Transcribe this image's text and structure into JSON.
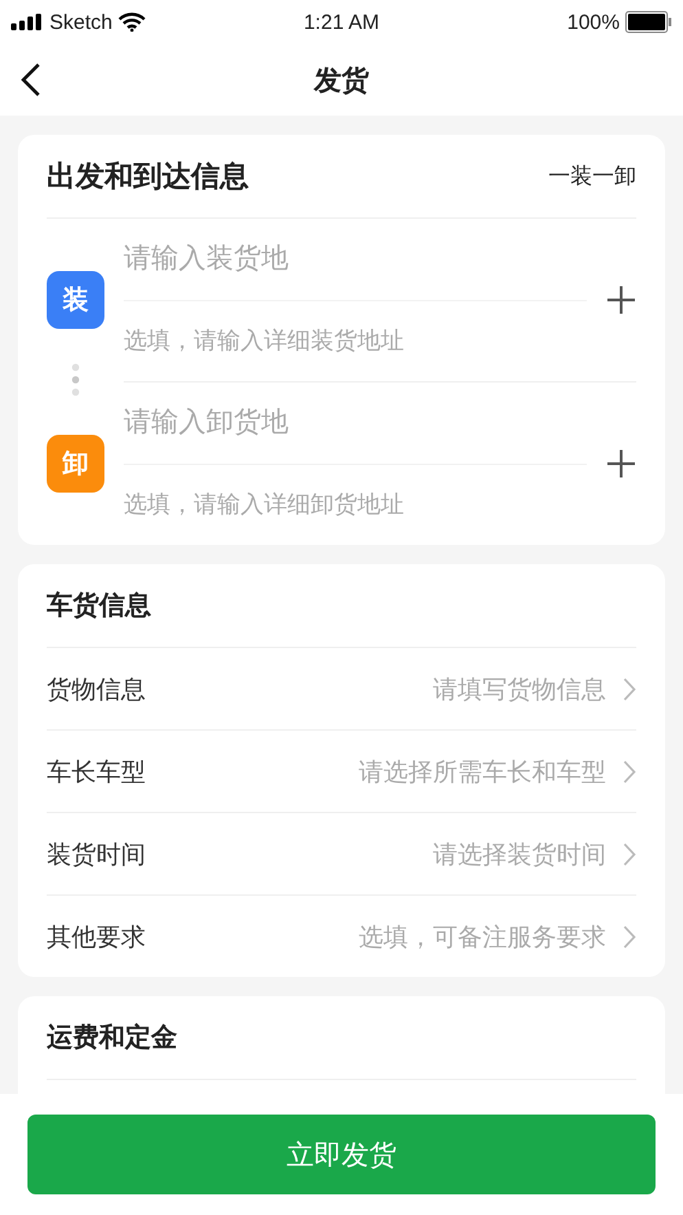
{
  "status_bar": {
    "carrier": "Sketch",
    "time": "1:21 AM",
    "battery": "100%"
  },
  "nav": {
    "title": "发货"
  },
  "route": {
    "title": "出发和到达信息",
    "mode": "一装一卸",
    "stops": [
      {
        "badge": "装",
        "color": "#3a7ff6",
        "placeholder": "请输入装货地",
        "detail_placeholder": "选填，请输入详细装货地址"
      },
      {
        "badge": "卸",
        "color": "#fb8c0c",
        "placeholder": "请输入卸货地",
        "detail_placeholder": "选填，请输入详细卸货地址"
      }
    ]
  },
  "cargo": {
    "title": "车货信息",
    "rows": [
      {
        "label": "货物信息",
        "hint": "请填写货物信息"
      },
      {
        "label": "车长车型",
        "hint": "请选择所需车长和车型"
      },
      {
        "label": "装货时间",
        "hint": "请选择装货时间"
      },
      {
        "label": "其他要求",
        "hint": "选填，可备注服务要求"
      }
    ]
  },
  "fees": {
    "title": "运费和定金"
  },
  "submit": "立即发货"
}
